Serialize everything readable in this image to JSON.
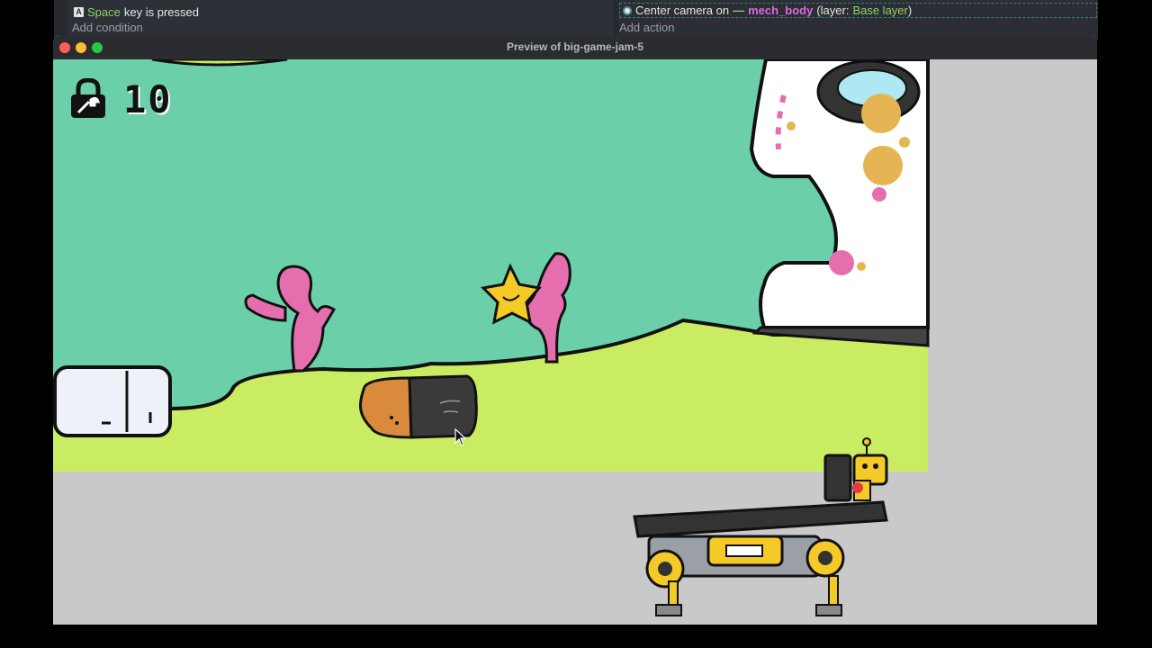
{
  "event_sheet": {
    "condition": {
      "key_name": "Space",
      "text": "key is pressed",
      "add_label": "Add condition"
    },
    "action": {
      "prefix": "Center camera on",
      "object": "mech_body",
      "layer_prefix": "(layer:",
      "layer_name": "Base layer",
      "layer_suffix": ")",
      "add_label": "Add action"
    }
  },
  "window": {
    "title": "Preview of big-game-jam-5"
  },
  "hud": {
    "icon": "padlock-wrench-icon",
    "counter": "10"
  },
  "colors": {
    "sky": "#6bcfaa",
    "ground": "#c9ec62",
    "offscreen": "#c9c9c9",
    "coral": "#e56fae",
    "star": "#f5c928",
    "battery_orange": "#d98a3d",
    "battery_dark": "#3a3a3a"
  }
}
